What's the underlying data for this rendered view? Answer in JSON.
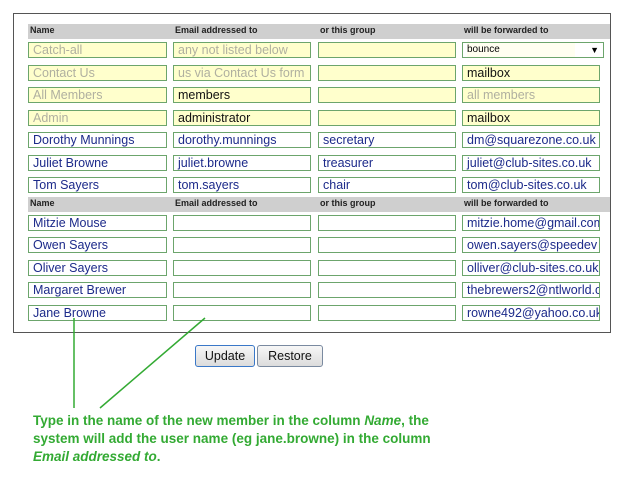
{
  "headers": [
    "Name",
    "Email addressed to",
    "or this group",
    "will be forwarded to"
  ],
  "special_rows": [
    {
      "name": "Catch-all",
      "email": "any not listed below",
      "group": "",
      "forward": "bounce",
      "type": "select"
    },
    {
      "name": "Contact Us",
      "email": "us via Contact Us form",
      "group": "",
      "forward": "mailbox"
    },
    {
      "name": "All Members",
      "email": "members",
      "group": "",
      "forward": "all members"
    },
    {
      "name": "Admin",
      "email": "administrator",
      "group": "",
      "forward": "mailbox"
    }
  ],
  "officer_rows": [
    {
      "name": "Dorothy Munnings",
      "email": "dorothy.munnings",
      "group": "secretary",
      "forward": "dm@squarezone.co.uk"
    },
    {
      "name": "Juliet Browne",
      "email": "juliet.browne",
      "group": "treasurer",
      "forward": "juliet@club-sites.co.uk"
    },
    {
      "name": "Tom Sayers",
      "email": "tom.sayers",
      "group": "chair",
      "forward": "tom@club-sites.co.uk"
    }
  ],
  "member_rows": [
    {
      "name": "Mitzie Mouse",
      "email": "",
      "group": "",
      "forward": "mitzie.home@gmail.com"
    },
    {
      "name": "Owen Sayers",
      "email": "",
      "group": "",
      "forward": "owen.sayers@speedev"
    },
    {
      "name": "Oliver Sayers",
      "email": "",
      "group": "",
      "forward": "olliver@club-sites.co.uk"
    },
    {
      "name": "Margaret Brewer",
      "email": "",
      "group": "",
      "forward": "thebrewers2@ntlworld.c"
    },
    {
      "name": "Jane Browne",
      "email": "",
      "group": "",
      "forward": "rowne492@yahoo.co.uk"
    }
  ],
  "buttons": {
    "update": "Update",
    "restore": "Restore"
  },
  "note": {
    "part1": "Type in the name of the new member in the column",
    "name_col": "Name",
    "part2": ", the system will add the user name (eg jane.browne) in the column",
    "email_col": "Email addressed to",
    "part3": "."
  },
  "colors": {
    "accent_green": "#33aa33",
    "field_border": "#6ca56c",
    "field_yellow": "#ffffcc",
    "text_blue": "#1c2a8a"
  }
}
